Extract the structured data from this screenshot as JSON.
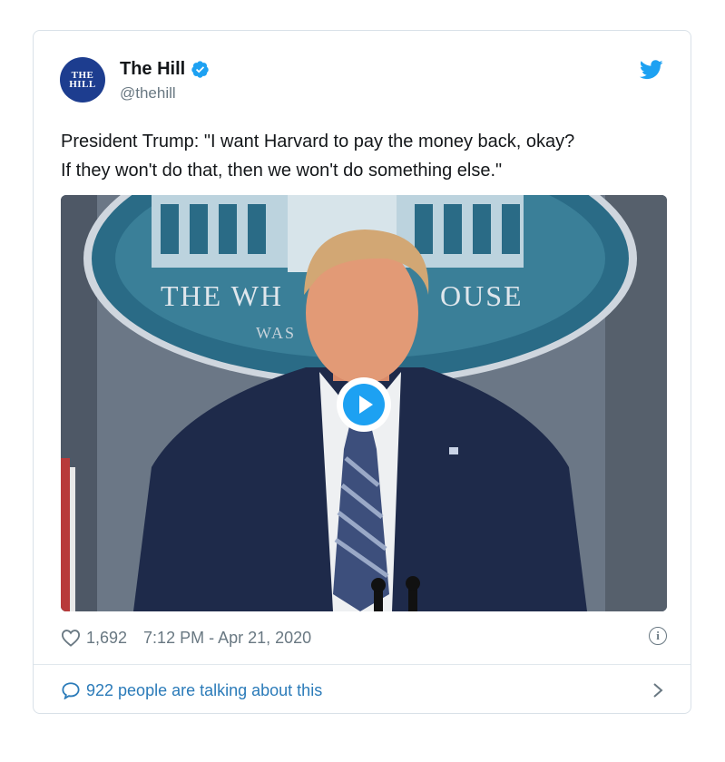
{
  "account": {
    "avatar_line1": "THE",
    "avatar_line2": "HILL",
    "name": "The Hill",
    "handle": "@thehill",
    "verified_icon": "verified-badge-icon"
  },
  "tweet": {
    "text_line1": "President Trump: \"I want Harvard to pay the money back, okay?",
    "text_line2": "If they won't do that, then we won't do something else.\""
  },
  "media": {
    "type": "video",
    "play_icon": "play-icon",
    "seal_text": "THE WH",
    "seal_text2": "OUSE",
    "seal_text3": "WAS"
  },
  "meta": {
    "likes": "1,692",
    "timestamp": "7:12 PM - Apr 21, 2020",
    "info_glyph": "i"
  },
  "footer": {
    "talking_label": "922 people are talking about this"
  },
  "colors": {
    "brand_blue": "#1da1f2",
    "link_blue": "#2b7bb9",
    "text_gray": "#697882",
    "avatar_navy": "#1d3d8f"
  }
}
